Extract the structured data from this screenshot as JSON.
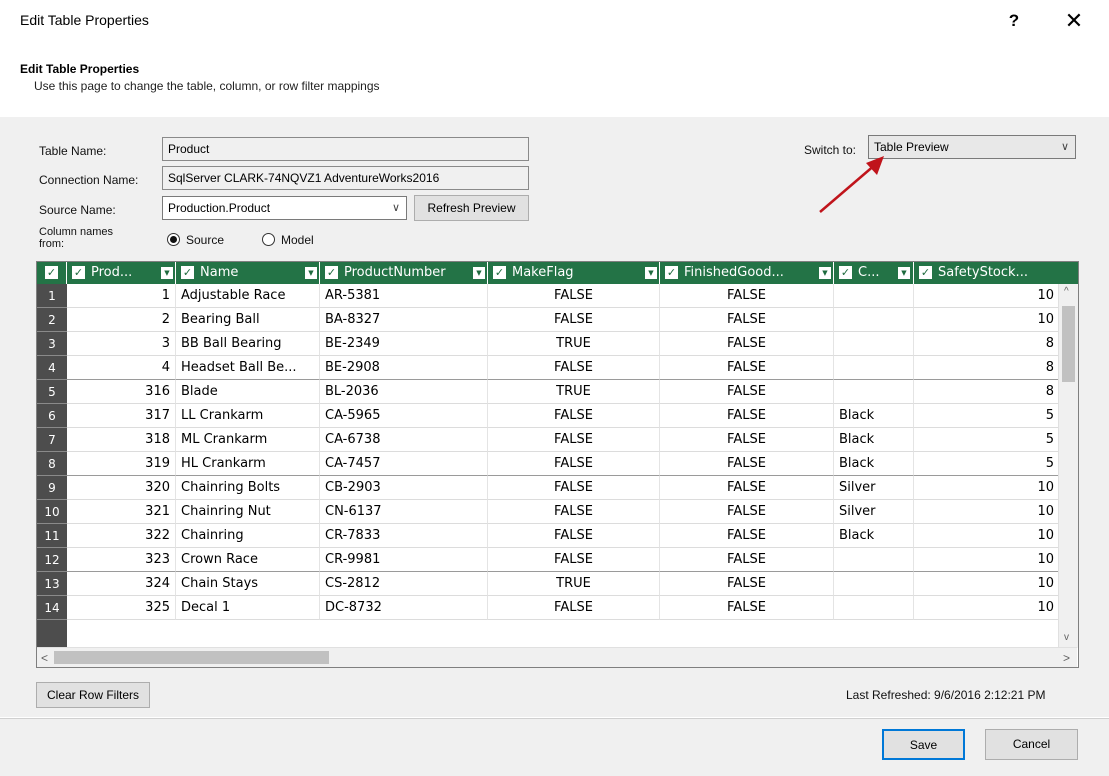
{
  "window": {
    "title": "Edit Table Properties",
    "help_glyph": "?",
    "close_glyph": "✕"
  },
  "header": {
    "title": "Edit Table Properties",
    "description": "Use this page to change the table, column, or row filter mappings"
  },
  "form": {
    "table_name_label": "Table Name:",
    "table_name_value": "Product",
    "connection_name_label": "Connection Name:",
    "connection_name_value": "SqlServer CLARK-74NQVZ1 AdventureWorks2016",
    "source_name_label": "Source Name:",
    "source_name_value": "Production.Product",
    "refresh_preview_label": "Refresh Preview",
    "column_names_from_label": "Column names from:",
    "radio_source_label": "Source",
    "radio_model_label": "Model",
    "radio_selected": "Source",
    "switch_to_label": "Switch to:",
    "switch_to_value": "Table Preview"
  },
  "grid": {
    "select_all_checked": true,
    "columns": [
      {
        "label": "Prod...",
        "checked": true
      },
      {
        "label": "Name",
        "checked": true
      },
      {
        "label": "ProductNumber",
        "checked": true
      },
      {
        "label": "MakeFlag",
        "checked": true
      },
      {
        "label": "FinishedGood...",
        "checked": true
      },
      {
        "label": "C...",
        "checked": true
      },
      {
        "label": "SafetyStock...",
        "checked": true
      }
    ],
    "rows": [
      {
        "n": "1",
        "id": "1",
        "name": "Adjustable Race",
        "pn": "AR-5381",
        "mf": "FALSE",
        "fg": "FALSE",
        "color": "",
        "ss": "10"
      },
      {
        "n": "2",
        "id": "2",
        "name": "Bearing Ball",
        "pn": "BA-8327",
        "mf": "FALSE",
        "fg": "FALSE",
        "color": "",
        "ss": "10"
      },
      {
        "n": "3",
        "id": "3",
        "name": "BB Ball Bearing",
        "pn": "BE-2349",
        "mf": "TRUE",
        "fg": "FALSE",
        "color": "",
        "ss": "8"
      },
      {
        "n": "4",
        "id": "4",
        "name": "Headset Ball Be...",
        "pn": "BE-2908",
        "mf": "FALSE",
        "fg": "FALSE",
        "color": "",
        "ss": "8"
      },
      {
        "n": "5",
        "id": "316",
        "name": "Blade",
        "pn": "BL-2036",
        "mf": "TRUE",
        "fg": "FALSE",
        "color": "",
        "ss": "8"
      },
      {
        "n": "6",
        "id": "317",
        "name": "LL Crankarm",
        "pn": "CA-5965",
        "mf": "FALSE",
        "fg": "FALSE",
        "color": "Black",
        "ss": "5"
      },
      {
        "n": "7",
        "id": "318",
        "name": "ML Crankarm",
        "pn": "CA-6738",
        "mf": "FALSE",
        "fg": "FALSE",
        "color": "Black",
        "ss": "5"
      },
      {
        "n": "8",
        "id": "319",
        "name": "HL Crankarm",
        "pn": "CA-7457",
        "mf": "FALSE",
        "fg": "FALSE",
        "color": "Black",
        "ss": "5"
      },
      {
        "n": "9",
        "id": "320",
        "name": "Chainring Bolts",
        "pn": "CB-2903",
        "mf": "FALSE",
        "fg": "FALSE",
        "color": "Silver",
        "ss": "10"
      },
      {
        "n": "10",
        "id": "321",
        "name": "Chainring Nut",
        "pn": "CN-6137",
        "mf": "FALSE",
        "fg": "FALSE",
        "color": "Silver",
        "ss": "10"
      },
      {
        "n": "11",
        "id": "322",
        "name": "Chainring",
        "pn": "CR-7833",
        "mf": "FALSE",
        "fg": "FALSE",
        "color": "Black",
        "ss": "10"
      },
      {
        "n": "12",
        "id": "323",
        "name": "Crown Race",
        "pn": "CR-9981",
        "mf": "FALSE",
        "fg": "FALSE",
        "color": "",
        "ss": "10"
      },
      {
        "n": "13",
        "id": "324",
        "name": "Chain Stays",
        "pn": "CS-2812",
        "mf": "TRUE",
        "fg": "FALSE",
        "color": "",
        "ss": "10"
      },
      {
        "n": "14",
        "id": "325",
        "name": "Decal 1",
        "pn": "DC-8732",
        "mf": "FALSE",
        "fg": "FALSE",
        "color": "",
        "ss": "10"
      }
    ],
    "group_separator_after_rows": [
      "4",
      "8",
      "12"
    ]
  },
  "footer": {
    "clear_row_filters_label": "Clear Row Filters",
    "last_refreshed": "Last Refreshed: 9/6/2016 2:12:21 PM",
    "save_label": "Save",
    "cancel_label": "Cancel"
  },
  "colors": {
    "grid_header": "#237346",
    "row_number_bg": "#4d4d4d",
    "annotation_arrow": "#c0141b",
    "save_border": "#0078d7"
  }
}
